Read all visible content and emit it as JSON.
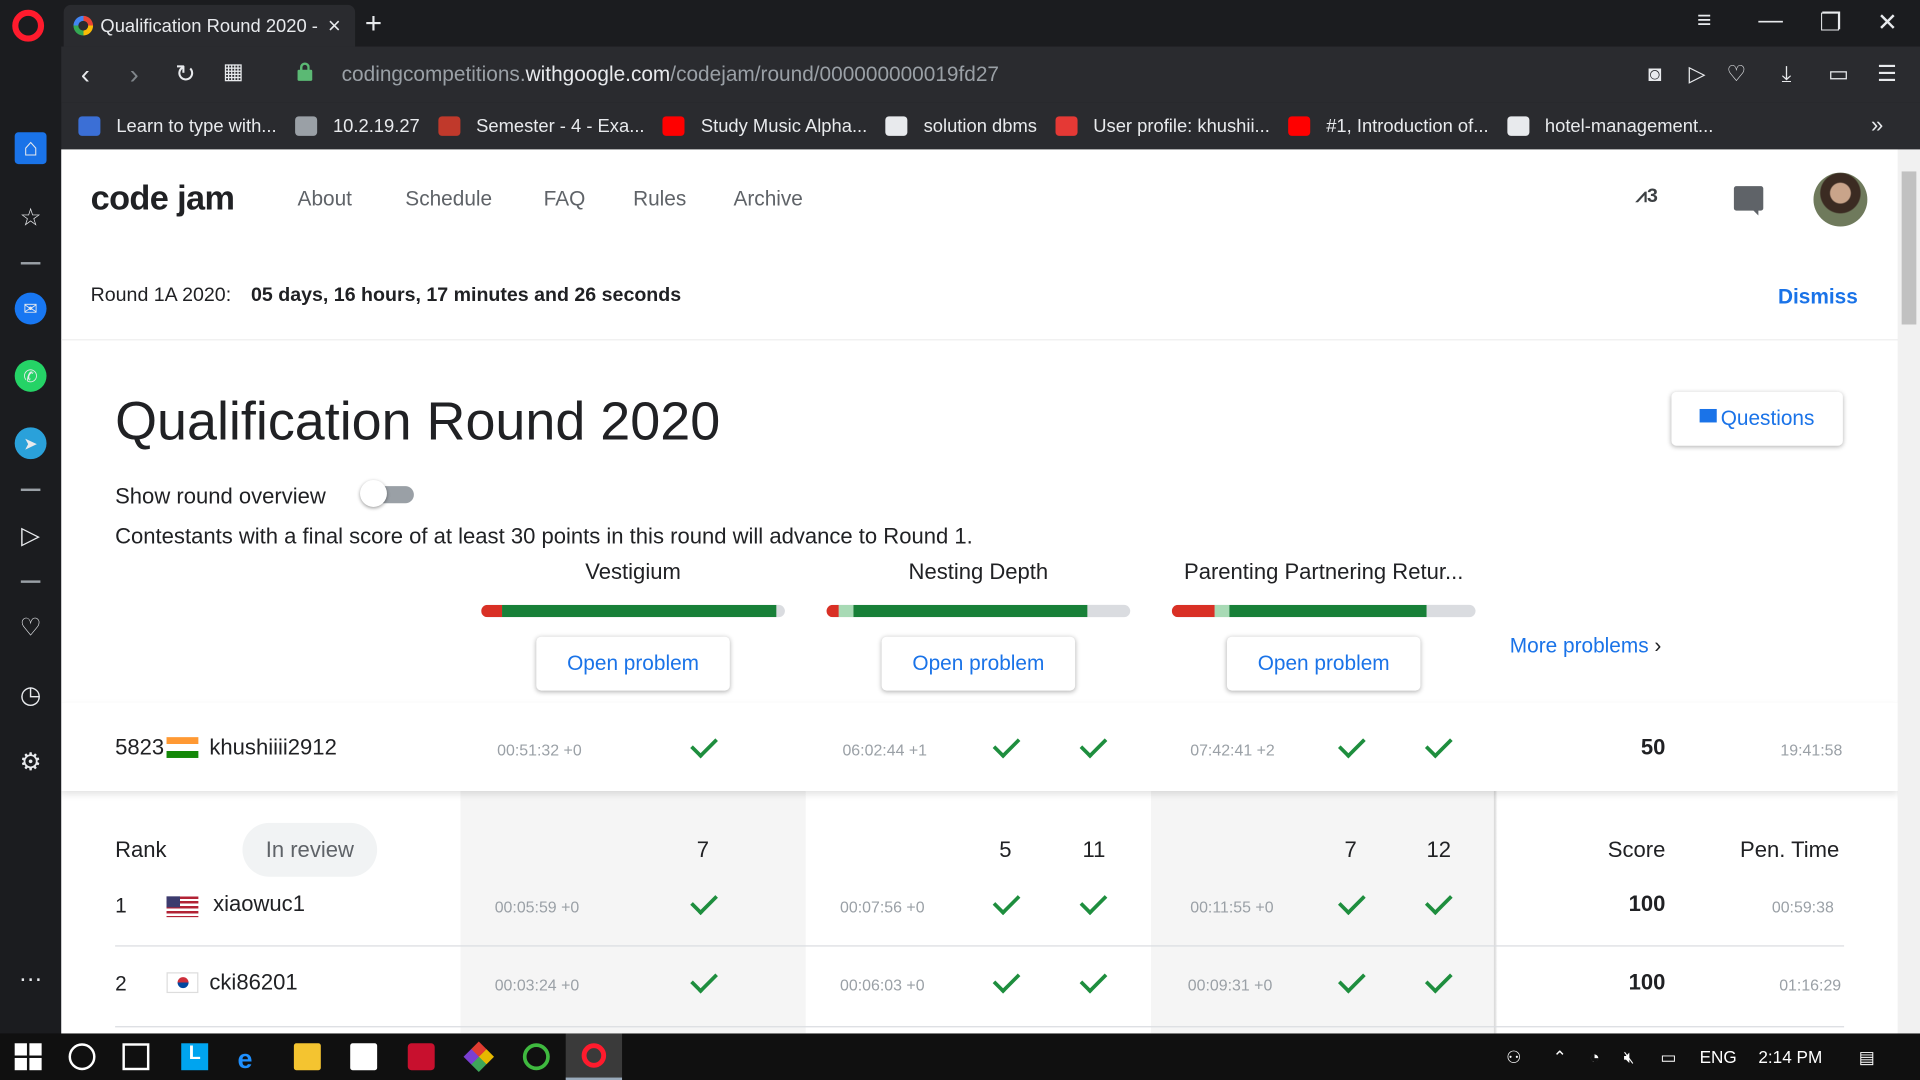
{
  "browser": {
    "tab_title": "Qualification Round 2020 -",
    "url_prefix": "codingcompetitions.",
    "url_domain": "withgoogle.com",
    "url_path": "/codejam/round/000000000019fd27",
    "bookmarks": [
      {
        "label": "Learn to type with...",
        "icon": "typing-icon",
        "color": "#3b6fd6"
      },
      {
        "label": "10.2.19.27",
        "icon": "gear-icon",
        "color": "#9aa0a6"
      },
      {
        "label": "Semester - 4 - Exa...",
        "icon": "shield-icon",
        "color": "#c0392b"
      },
      {
        "label": "Study Music Alpha...",
        "icon": "youtube-icon",
        "color": "#ff0000"
      },
      {
        "label": "solution dbms",
        "icon": "document-icon",
        "color": "#e8eaed"
      },
      {
        "label": "User profile: khushii...",
        "icon": "prohibited-icon",
        "color": "#e53935"
      },
      {
        "label": "#1, Introduction of...",
        "icon": "youtube-icon",
        "color": "#ff0000"
      },
      {
        "label": "hotel-management...",
        "icon": "github-icon",
        "color": "#e8eaed"
      }
    ]
  },
  "header": {
    "logo": "code jam",
    "nav": [
      "About",
      "Schedule",
      "FAQ",
      "Rules",
      "Archive"
    ],
    "trend_count": "3"
  },
  "banner": {
    "label": "Round 1A 2020:",
    "countdown": "05 days, 16 hours, 17 minutes and 26 seconds",
    "dismiss": "Dismiss"
  },
  "round": {
    "title": "Qualification Round 2020",
    "questions_label": "Questions",
    "overview_label": "Show round overview",
    "overview_enabled": false,
    "advance_text": "Contestants with a final score of at least 30 points in this round will advance to Round 1.",
    "open_label": "Open problem",
    "more_label": "More problems",
    "problems": [
      {
        "name": "Vestigium",
        "bar": [
          {
            "frac": 0.07,
            "color": "#d93025"
          },
          {
            "frac": 0.9,
            "color": "#188038"
          }
        ]
      },
      {
        "name": "Nesting Depth",
        "bar": [
          {
            "frac": 0.04,
            "color": "#d93025"
          },
          {
            "frac": 0.05,
            "color": "#a8dab5"
          },
          {
            "frac": 0.77,
            "color": "#188038"
          }
        ]
      },
      {
        "name": "Parenting Partnering Retur...",
        "bar": [
          {
            "frac": 0.14,
            "color": "#d93025"
          },
          {
            "frac": 0.05,
            "color": "#a8dab5"
          },
          {
            "frac": 0.65,
            "color": "#188038"
          }
        ]
      }
    ]
  },
  "my_row": {
    "rank": "5823",
    "country": "India",
    "user": "khushiiii2912",
    "times": [
      "00:51:32 +0",
      "06:02:44 +1",
      "07:42:41 +2"
    ],
    "score": "50",
    "pen_time": "19:41:58"
  },
  "table": {
    "rank_header": "Rank",
    "in_review": "In review",
    "points": [
      "7",
      "5",
      "11",
      "7",
      "12"
    ],
    "score_header": "Score",
    "pen_header": "Pen. Time",
    "rows": [
      {
        "rank": "1",
        "country": "United States",
        "user": "xiaowuc1",
        "times": [
          "00:05:59 +0",
          "00:07:56 +0",
          "00:11:55 +0"
        ],
        "score": "100",
        "pen_time": "00:59:38"
      },
      {
        "rank": "2",
        "country": "South Korea",
        "user": "cki86201",
        "times": [
          "00:03:24 +0",
          "00:06:03 +0",
          "00:09:31 +0"
        ],
        "score": "100",
        "pen_time": "01:16:29"
      }
    ]
  },
  "taskbar": {
    "language": "ENG",
    "clock": "2:14 PM"
  }
}
